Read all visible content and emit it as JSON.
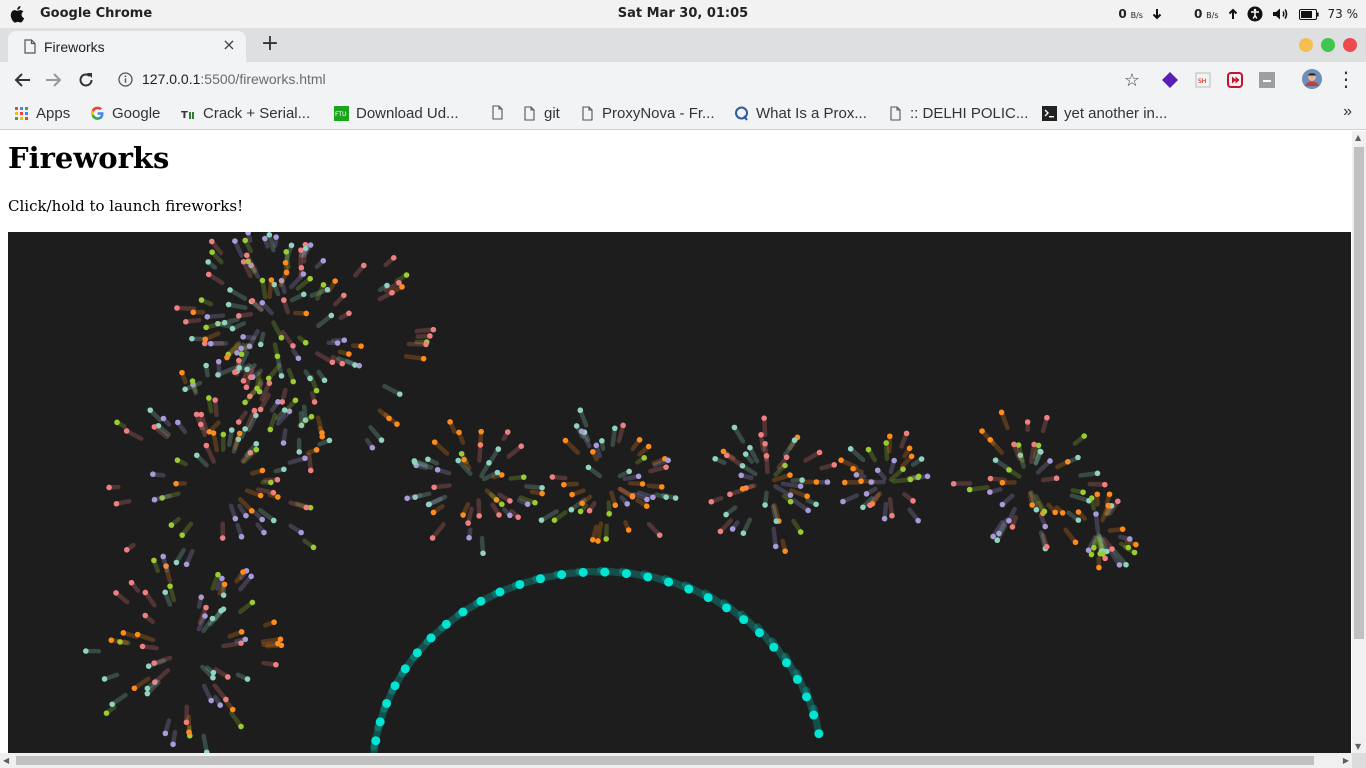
{
  "system_bar": {
    "app_name": "Google Chrome",
    "clock": "Sat Mar 30, 01:05",
    "net_down_value": "0",
    "net_down_unit": "B/s",
    "net_up_value": "0",
    "net_up_unit": "B/s",
    "battery": "73 %"
  },
  "browser": {
    "tab_title": "Fireworks",
    "tab_close": "×",
    "new_tab": "+",
    "url_host": "127.0.0.1",
    "url_path": ":5500/fireworks.html",
    "star": "☆",
    "more": "⋮"
  },
  "bookmarks": {
    "items": [
      {
        "label": "Apps",
        "icon": "apps-grid-icon"
      },
      {
        "label": "Google",
        "icon": "google-icon"
      },
      {
        "label": "Crack + Serial...",
        "icon": "site-icon"
      },
      {
        "label": "Download Ud...",
        "icon": "ftu-icon"
      },
      {
        "label": "",
        "icon": "page-icon"
      },
      {
        "label": "git",
        "icon": "page-icon"
      },
      {
        "label": "ProxyNova - Fr...",
        "icon": "page-icon"
      },
      {
        "label": "What Is a Prox...",
        "icon": "site-icon"
      },
      {
        "label": ":: DELHI POLIC...",
        "icon": "page-icon"
      },
      {
        "label": "yet another in...",
        "icon": "terminal-icon"
      }
    ],
    "overflow": "»"
  },
  "page": {
    "heading": "Fireworks",
    "instruction": "Click/hold to launch fireworks!"
  },
  "colors": {
    "canvas_bg": "#1d1d1d",
    "firework_palette": [
      "#ff8c1a",
      "#9acd32",
      "#a89bd9",
      "#f08080",
      "#8fd3c0",
      "#00e5d4"
    ],
    "traffic_lights": [
      "#f4bf4f",
      "#3fc64c",
      "#ed4a4f"
    ]
  }
}
